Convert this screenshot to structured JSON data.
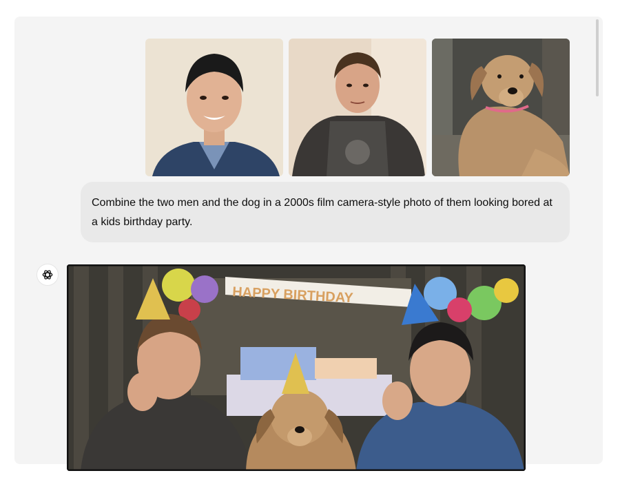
{
  "conversation": {
    "user_message": "Combine the two men and the dog in a 2000s film camera-style photo of them looking bored at a kids birthday party.",
    "uploaded_images": [
      {
        "subject": "man-smiling-blue-jacket"
      },
      {
        "subject": "man-dark-shirt"
      },
      {
        "subject": "tan-dog-pink-collar"
      }
    ],
    "assistant": {
      "avatar_icon": "openai-logo-icon",
      "image_banner_text": "HAPPY BIRTHDAY"
    }
  },
  "colors": {
    "panel_bg": "#f4f4f4",
    "bubble_bg": "#e9e9e9",
    "text": "#0d0d0d"
  }
}
